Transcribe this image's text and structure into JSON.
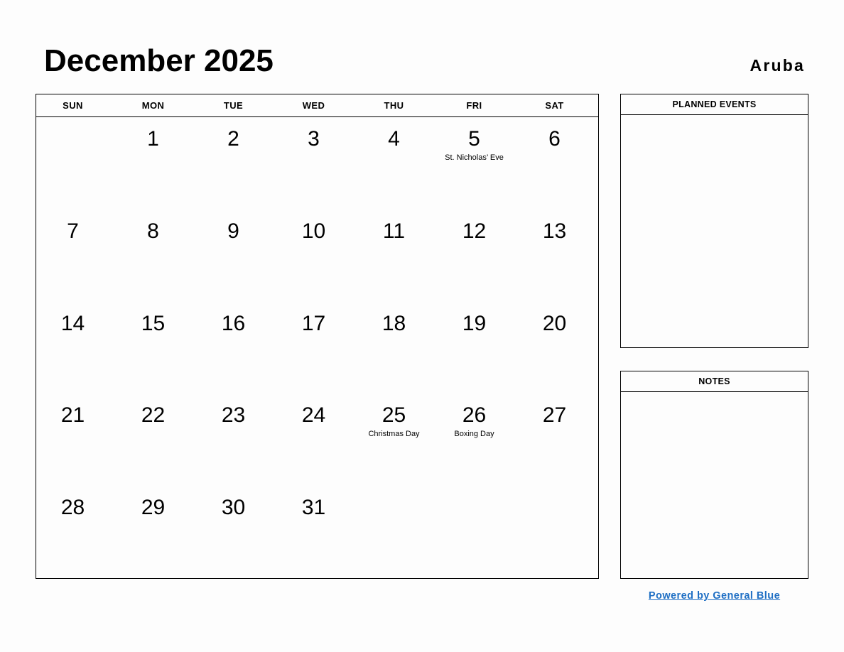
{
  "header": {
    "month_title": "December 2025",
    "region": "Aruba"
  },
  "calendar": {
    "weekdays": [
      "SUN",
      "MON",
      "TUE",
      "WED",
      "THU",
      "FRI",
      "SAT"
    ],
    "weeks": [
      [
        {
          "day": "",
          "event": ""
        },
        {
          "day": "1",
          "event": ""
        },
        {
          "day": "2",
          "event": ""
        },
        {
          "day": "3",
          "event": ""
        },
        {
          "day": "4",
          "event": ""
        },
        {
          "day": "5",
          "event": "St. Nicholas’ Eve"
        },
        {
          "day": "6",
          "event": ""
        }
      ],
      [
        {
          "day": "7",
          "event": ""
        },
        {
          "day": "8",
          "event": ""
        },
        {
          "day": "9",
          "event": ""
        },
        {
          "day": "10",
          "event": ""
        },
        {
          "day": "11",
          "event": ""
        },
        {
          "day": "12",
          "event": ""
        },
        {
          "day": "13",
          "event": ""
        }
      ],
      [
        {
          "day": "14",
          "event": ""
        },
        {
          "day": "15",
          "event": ""
        },
        {
          "day": "16",
          "event": ""
        },
        {
          "day": "17",
          "event": ""
        },
        {
          "day": "18",
          "event": ""
        },
        {
          "day": "19",
          "event": ""
        },
        {
          "day": "20",
          "event": ""
        }
      ],
      [
        {
          "day": "21",
          "event": ""
        },
        {
          "day": "22",
          "event": ""
        },
        {
          "day": "23",
          "event": ""
        },
        {
          "day": "24",
          "event": ""
        },
        {
          "day": "25",
          "event": "Christmas Day"
        },
        {
          "day": "26",
          "event": "Boxing Day"
        },
        {
          "day": "27",
          "event": ""
        }
      ],
      [
        {
          "day": "28",
          "event": ""
        },
        {
          "day": "29",
          "event": ""
        },
        {
          "day": "30",
          "event": ""
        },
        {
          "day": "31",
          "event": ""
        },
        {
          "day": "",
          "event": ""
        },
        {
          "day": "",
          "event": ""
        },
        {
          "day": "",
          "event": ""
        }
      ]
    ]
  },
  "panels": {
    "planned_events": {
      "title": "PLANNED EVENTS",
      "content": ""
    },
    "notes": {
      "title": "NOTES",
      "content": ""
    }
  },
  "footer": {
    "link_label": "Powered by General Blue",
    "link_color": "#1f6fc4"
  }
}
